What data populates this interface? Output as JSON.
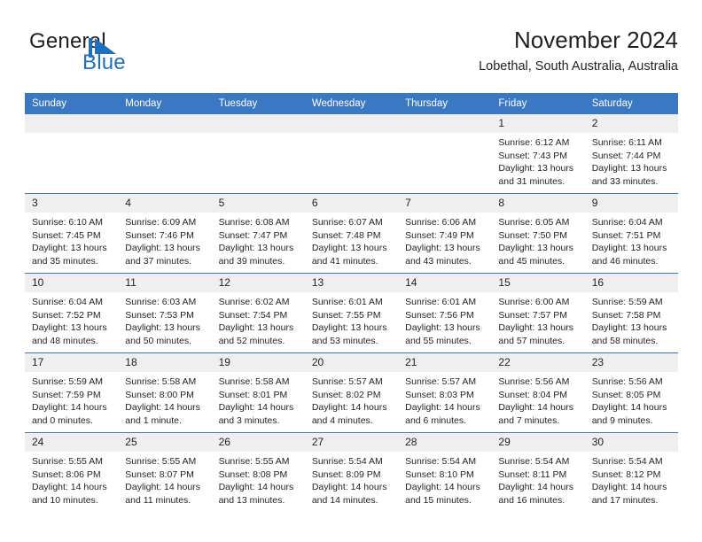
{
  "brand": {
    "name_part1": "General",
    "name_part2": "Blue",
    "mark": "triangle-logo"
  },
  "header": {
    "title": "November 2024",
    "subtitle": "Lobethal, South Australia, Australia"
  },
  "colors": {
    "header_blue": "#3b78c3",
    "daynum_gray": "#efefef",
    "brand_blue": "#1e6fc0",
    "text": "#231f20"
  },
  "weekday_headers": [
    "Sunday",
    "Monday",
    "Tuesday",
    "Wednesday",
    "Thursday",
    "Friday",
    "Saturday"
  ],
  "weeks": [
    [
      {
        "day": "",
        "empty": true
      },
      {
        "day": "",
        "empty": true
      },
      {
        "day": "",
        "empty": true
      },
      {
        "day": "",
        "empty": true
      },
      {
        "day": "",
        "empty": true
      },
      {
        "day": "1",
        "sunrise": "Sunrise: 6:12 AM",
        "sunset": "Sunset: 7:43 PM",
        "daylight": "Daylight: 13 hours and 31 minutes."
      },
      {
        "day": "2",
        "sunrise": "Sunrise: 6:11 AM",
        "sunset": "Sunset: 7:44 PM",
        "daylight": "Daylight: 13 hours and 33 minutes."
      }
    ],
    [
      {
        "day": "3",
        "sunrise": "Sunrise: 6:10 AM",
        "sunset": "Sunset: 7:45 PM",
        "daylight": "Daylight: 13 hours and 35 minutes."
      },
      {
        "day": "4",
        "sunrise": "Sunrise: 6:09 AM",
        "sunset": "Sunset: 7:46 PM",
        "daylight": "Daylight: 13 hours and 37 minutes."
      },
      {
        "day": "5",
        "sunrise": "Sunrise: 6:08 AM",
        "sunset": "Sunset: 7:47 PM",
        "daylight": "Daylight: 13 hours and 39 minutes."
      },
      {
        "day": "6",
        "sunrise": "Sunrise: 6:07 AM",
        "sunset": "Sunset: 7:48 PM",
        "daylight": "Daylight: 13 hours and 41 minutes."
      },
      {
        "day": "7",
        "sunrise": "Sunrise: 6:06 AM",
        "sunset": "Sunset: 7:49 PM",
        "daylight": "Daylight: 13 hours and 43 minutes."
      },
      {
        "day": "8",
        "sunrise": "Sunrise: 6:05 AM",
        "sunset": "Sunset: 7:50 PM",
        "daylight": "Daylight: 13 hours and 45 minutes."
      },
      {
        "day": "9",
        "sunrise": "Sunrise: 6:04 AM",
        "sunset": "Sunset: 7:51 PM",
        "daylight": "Daylight: 13 hours and 46 minutes."
      }
    ],
    [
      {
        "day": "10",
        "sunrise": "Sunrise: 6:04 AM",
        "sunset": "Sunset: 7:52 PM",
        "daylight": "Daylight: 13 hours and 48 minutes."
      },
      {
        "day": "11",
        "sunrise": "Sunrise: 6:03 AM",
        "sunset": "Sunset: 7:53 PM",
        "daylight": "Daylight: 13 hours and 50 minutes."
      },
      {
        "day": "12",
        "sunrise": "Sunrise: 6:02 AM",
        "sunset": "Sunset: 7:54 PM",
        "daylight": "Daylight: 13 hours and 52 minutes."
      },
      {
        "day": "13",
        "sunrise": "Sunrise: 6:01 AM",
        "sunset": "Sunset: 7:55 PM",
        "daylight": "Daylight: 13 hours and 53 minutes."
      },
      {
        "day": "14",
        "sunrise": "Sunrise: 6:01 AM",
        "sunset": "Sunset: 7:56 PM",
        "daylight": "Daylight: 13 hours and 55 minutes."
      },
      {
        "day": "15",
        "sunrise": "Sunrise: 6:00 AM",
        "sunset": "Sunset: 7:57 PM",
        "daylight": "Daylight: 13 hours and 57 minutes."
      },
      {
        "day": "16",
        "sunrise": "Sunrise: 5:59 AM",
        "sunset": "Sunset: 7:58 PM",
        "daylight": "Daylight: 13 hours and 58 minutes."
      }
    ],
    [
      {
        "day": "17",
        "sunrise": "Sunrise: 5:59 AM",
        "sunset": "Sunset: 7:59 PM",
        "daylight": "Daylight: 14 hours and 0 minutes."
      },
      {
        "day": "18",
        "sunrise": "Sunrise: 5:58 AM",
        "sunset": "Sunset: 8:00 PM",
        "daylight": "Daylight: 14 hours and 1 minute."
      },
      {
        "day": "19",
        "sunrise": "Sunrise: 5:58 AM",
        "sunset": "Sunset: 8:01 PM",
        "daylight": "Daylight: 14 hours and 3 minutes."
      },
      {
        "day": "20",
        "sunrise": "Sunrise: 5:57 AM",
        "sunset": "Sunset: 8:02 PM",
        "daylight": "Daylight: 14 hours and 4 minutes."
      },
      {
        "day": "21",
        "sunrise": "Sunrise: 5:57 AM",
        "sunset": "Sunset: 8:03 PM",
        "daylight": "Daylight: 14 hours and 6 minutes."
      },
      {
        "day": "22",
        "sunrise": "Sunrise: 5:56 AM",
        "sunset": "Sunset: 8:04 PM",
        "daylight": "Daylight: 14 hours and 7 minutes."
      },
      {
        "day": "23",
        "sunrise": "Sunrise: 5:56 AM",
        "sunset": "Sunset: 8:05 PM",
        "daylight": "Daylight: 14 hours and 9 minutes."
      }
    ],
    [
      {
        "day": "24",
        "sunrise": "Sunrise: 5:55 AM",
        "sunset": "Sunset: 8:06 PM",
        "daylight": "Daylight: 14 hours and 10 minutes."
      },
      {
        "day": "25",
        "sunrise": "Sunrise: 5:55 AM",
        "sunset": "Sunset: 8:07 PM",
        "daylight": "Daylight: 14 hours and 11 minutes."
      },
      {
        "day": "26",
        "sunrise": "Sunrise: 5:55 AM",
        "sunset": "Sunset: 8:08 PM",
        "daylight": "Daylight: 14 hours and 13 minutes."
      },
      {
        "day": "27",
        "sunrise": "Sunrise: 5:54 AM",
        "sunset": "Sunset: 8:09 PM",
        "daylight": "Daylight: 14 hours and 14 minutes."
      },
      {
        "day": "28",
        "sunrise": "Sunrise: 5:54 AM",
        "sunset": "Sunset: 8:10 PM",
        "daylight": "Daylight: 14 hours and 15 minutes."
      },
      {
        "day": "29",
        "sunrise": "Sunrise: 5:54 AM",
        "sunset": "Sunset: 8:11 PM",
        "daylight": "Daylight: 14 hours and 16 minutes."
      },
      {
        "day": "30",
        "sunrise": "Sunrise: 5:54 AM",
        "sunset": "Sunset: 8:12 PM",
        "daylight": "Daylight: 14 hours and 17 minutes."
      }
    ]
  ]
}
